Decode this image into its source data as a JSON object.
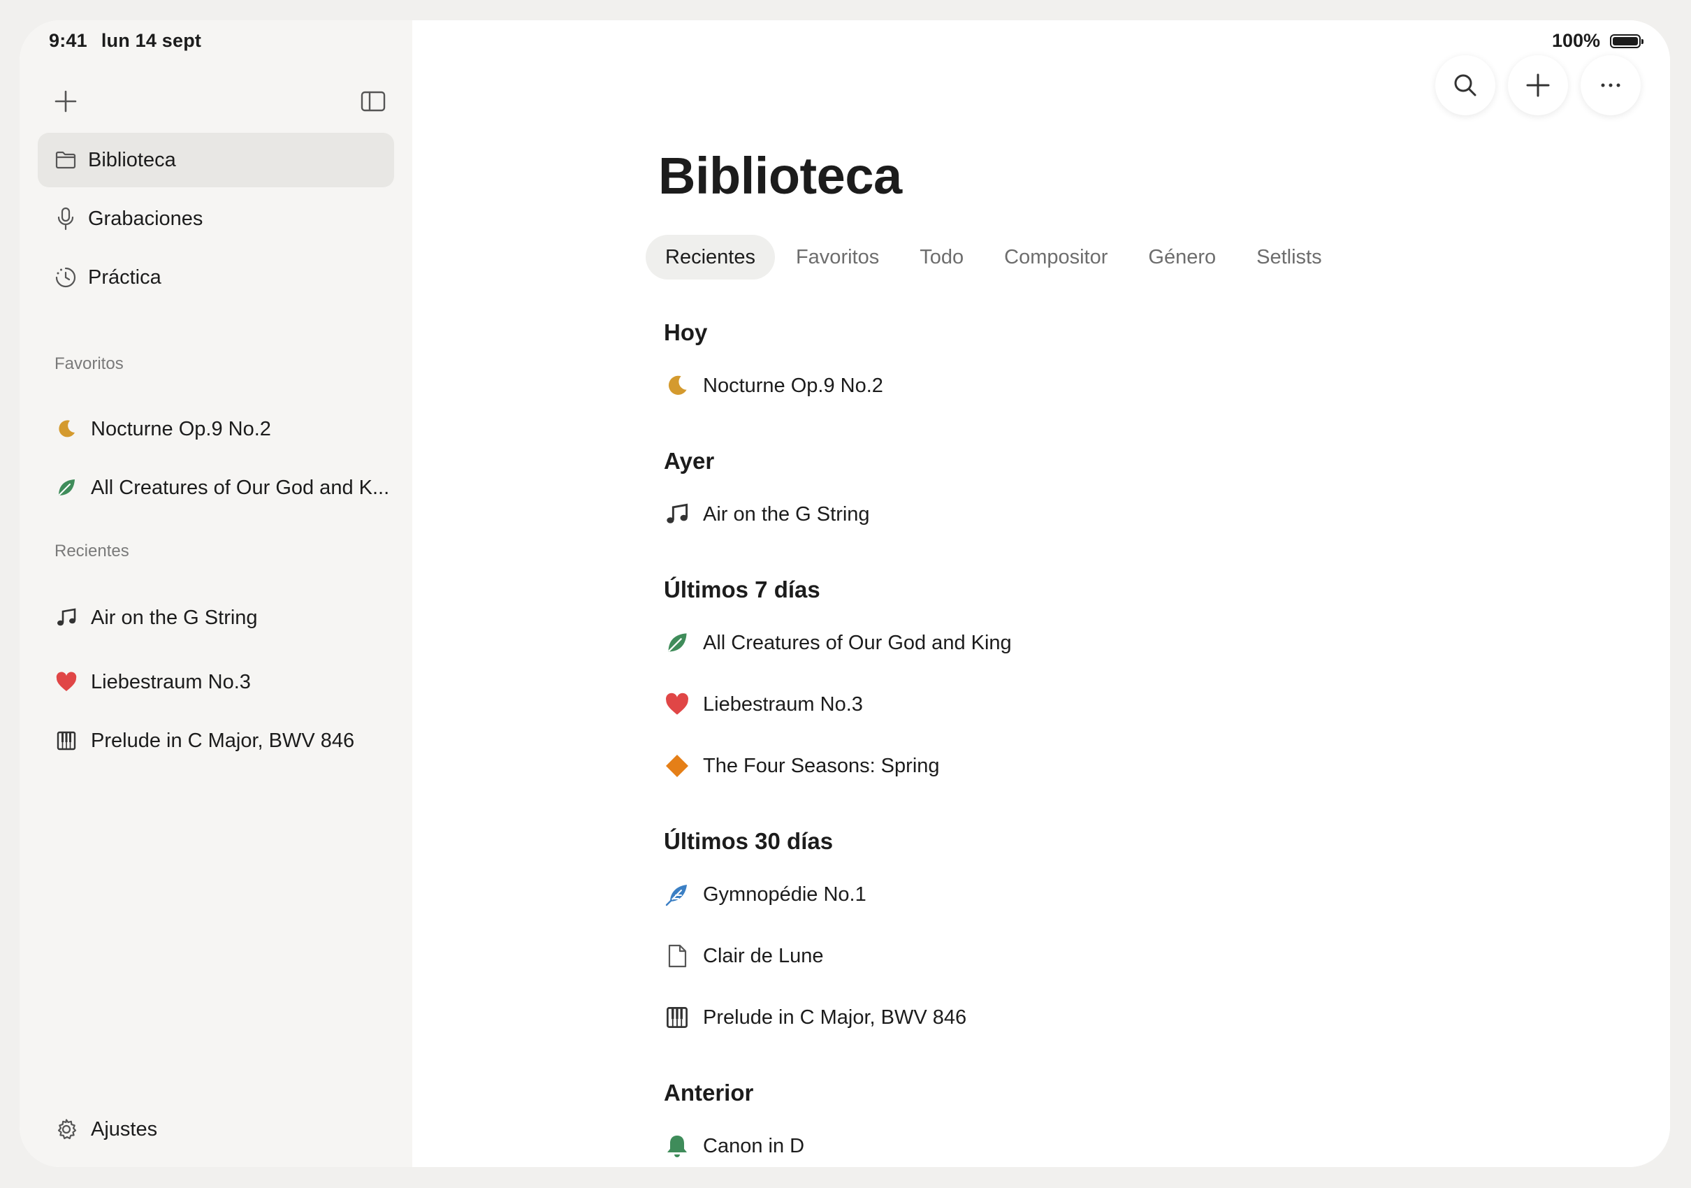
{
  "status": {
    "time": "9:41",
    "date": "lun 14 sept",
    "battery": "100%"
  },
  "sidebar": {
    "nav": [
      {
        "label": "Biblioteca",
        "icon": "folder-icon",
        "active": true
      },
      {
        "label": "Grabaciones",
        "icon": "microphone-icon"
      },
      {
        "label": "Práctica",
        "icon": "practice-timer-icon"
      }
    ],
    "favorites_title": "Favoritos",
    "favorites": [
      {
        "label": "Nocturne Op.9 No.2",
        "icon": "moon-icon"
      },
      {
        "label": "All Creatures of Our God and K...",
        "icon": "leaf-icon"
      }
    ],
    "recents_title": "Recientes",
    "recents": [
      {
        "label": "Air on the G String",
        "icon": "music-note-icon"
      },
      {
        "label": "Liebestraum No.3",
        "icon": "heart-icon"
      },
      {
        "label": "Prelude in C Major, BWV 846",
        "icon": "piano-icon"
      }
    ],
    "settings_label": "Ajustes"
  },
  "main": {
    "title": "Biblioteca",
    "tabs": [
      "Recientes",
      "Favoritos",
      "Todo",
      "Compositor",
      "Género",
      "Setlists"
    ],
    "groups": [
      {
        "title": "Hoy",
        "items": [
          {
            "label": "Nocturne Op.9 No.2",
            "icon": "moon-icon"
          }
        ]
      },
      {
        "title": "Ayer",
        "items": [
          {
            "label": "Air on the G String",
            "icon": "music-note-icon"
          }
        ]
      },
      {
        "title": "Últimos 7 días",
        "items": [
          {
            "label": "All Creatures of Our God and King",
            "icon": "leaf-icon"
          },
          {
            "label": "Liebestraum No.3",
            "icon": "heart-icon"
          },
          {
            "label": "The Four Seasons: Spring",
            "icon": "diamond-icon"
          }
        ]
      },
      {
        "title": "Últimos 30 días",
        "items": [
          {
            "label": "Gymnopédie No.1",
            "icon": "feather-icon"
          },
          {
            "label": "Clair de Lune",
            "icon": "document-icon"
          },
          {
            "label": "Prelude in C Major, BWV 846",
            "icon": "piano-icon"
          }
        ]
      },
      {
        "title": "Anterior",
        "items": [
          {
            "label": "Canon in D",
            "icon": "bell-icon"
          }
        ]
      }
    ]
  },
  "colors": {
    "moon": "#d49a2e",
    "leaf": "#3f8c5a",
    "heart": "#e04646",
    "diamond": "#e57f17",
    "feather": "#3b7fc4",
    "bell": "#3f8c5a"
  }
}
